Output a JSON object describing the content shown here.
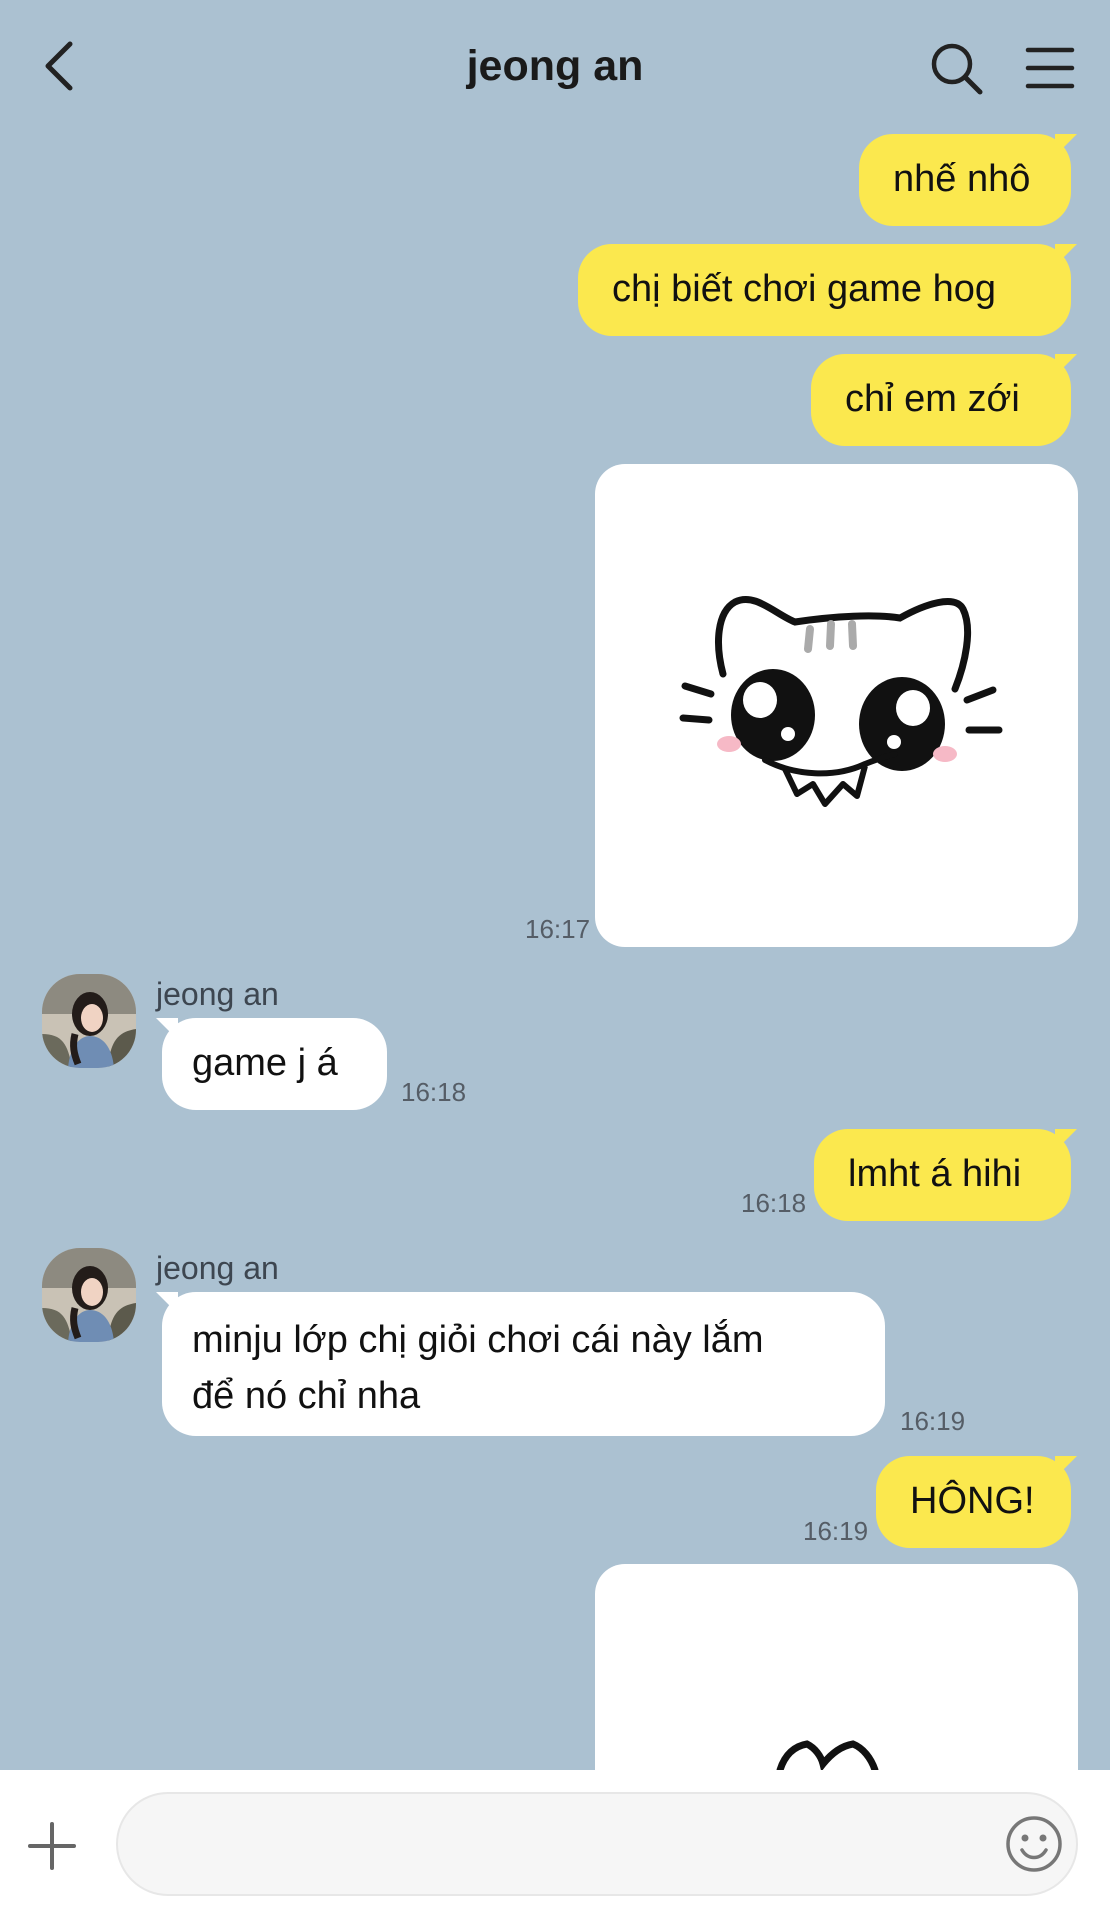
{
  "header": {
    "title": "jeong an",
    "back_icon": "chevron-left-icon",
    "search_icon": "search-icon",
    "menu_icon": "hamburger-menu-icon"
  },
  "messages": [
    {
      "from": "me",
      "text": "nhế nhô"
    },
    {
      "from": "me",
      "text": "chị biết chơi game hog"
    },
    {
      "from": "me",
      "text": "chỉ em zới"
    },
    {
      "from": "me",
      "type": "sticker",
      "sticker": "white-cat-sticker",
      "time": "16:17"
    },
    {
      "from": "other",
      "sender": "jeong an",
      "text": "game j á",
      "time": "16:18"
    },
    {
      "from": "me",
      "text": "lmht á hihi",
      "time": "16:18"
    },
    {
      "from": "other",
      "sender": "jeong an",
      "text_line1": "minju lớp chị giỏi chơi cái này lắm",
      "text_line2": "để nó chỉ nha",
      "time": "16:19"
    },
    {
      "from": "me",
      "text": "HÔNG!",
      "time": "16:19"
    },
    {
      "from": "me",
      "type": "sticker",
      "sticker": "white-cat-sticker"
    }
  ],
  "input": {
    "value": "",
    "placeholder": "",
    "plus_icon": "plus-icon",
    "emoji_icon": "emoji-icon"
  },
  "colors": {
    "background": "#abc1d1",
    "my_bubble": "#fbe84e",
    "other_bubble": "#ffffff"
  }
}
